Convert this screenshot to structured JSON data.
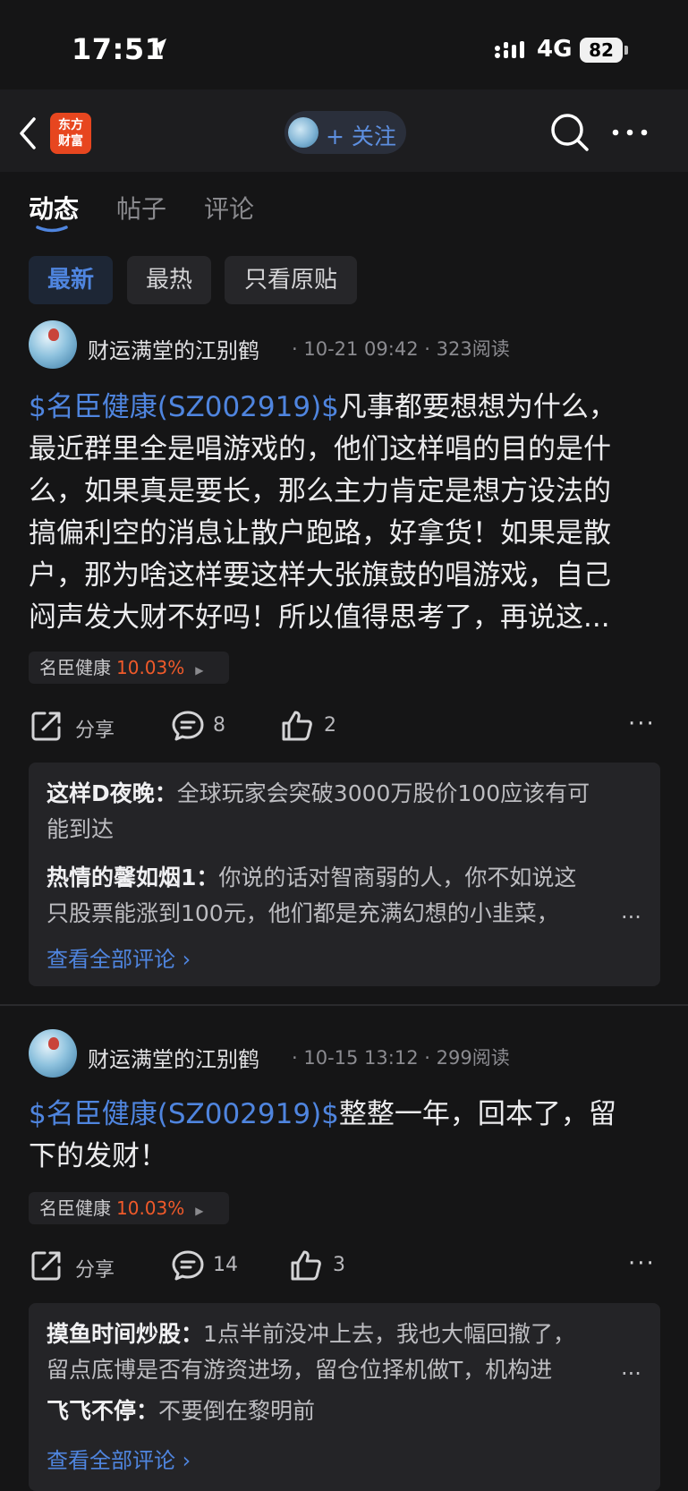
{
  "status_bar": {
    "time": "17:51",
    "network": "4G",
    "battery": "82"
  },
  "nav": {
    "logo_text": "东方财富",
    "follow_label": "+ 关注"
  },
  "tabs": [
    {
      "label": "动态"
    },
    {
      "label": "帖子"
    },
    {
      "label": "评论"
    }
  ],
  "filters": [
    {
      "label": "最新"
    },
    {
      "label": "最热"
    },
    {
      "label": "只看原贴"
    }
  ],
  "colors": {
    "accent_blue": "#4f85df",
    "up_red": "#f05a2a",
    "background": "#151516"
  },
  "posts": [
    {
      "author": "财运满堂的江别鹤",
      "date": "10-21 09:42",
      "reads": "323阅读",
      "cashtag": "$名臣健康(SZ002919)$",
      "body_lines": [
        "凡事都要想想为什么，",
        "最近群里全是唱游戏的，他们这样唱的目的是什",
        "么，如果真是要长，那么主力肯定是想方设法的",
        "搞偏利空的消息让散户跑路，好拿货！如果是散",
        "户，那为啥这样要这样大张旗鼓的唱游戏，自己",
        "闷声发大财不好吗！所以值得思考了，再说这..."
      ],
      "stock": {
        "name": "名臣健康",
        "change": "10.03%"
      },
      "share_label": "分享",
      "comment_count": "8",
      "like_count": "2",
      "comments": [
        {
          "user": "这样D夜晚",
          "sep": "：",
          "text_lines": [
            "全球玩家会突破3000万股价100应该有可",
            "能到达"
          ]
        },
        {
          "user": "热情的馨如烟1",
          "sep": "：",
          "text_lines": [
            "你说的话对智商弱的人，你不如说这",
            "只股票能涨到100元，他们都是充满幻想的小韭菜，"
          ]
        }
      ],
      "ellipsis": "...",
      "view_all": "查看全部评论 ›"
    },
    {
      "author": "财运满堂的江别鹤",
      "date": "10-15 13:12",
      "reads": "299阅读",
      "cashtag": "$名臣健康(SZ002919)$",
      "body_lines": [
        "整整一年，回本了，留",
        "下的发财！"
      ],
      "stock": {
        "name": "名臣健康",
        "change": "10.03%"
      },
      "share_label": "分享",
      "comment_count": "14",
      "like_count": "3",
      "comments": [
        {
          "user": "摸鱼时间炒股",
          "sep": "：",
          "text_lines": [
            "1点半前没冲上去，我也大幅回撤了，",
            "留点底博是否有游资进场，留仓位择机做T，机构进"
          ]
        },
        {
          "user": "飞飞不停",
          "sep": "：",
          "text_lines": [
            "不要倒在黎明前"
          ]
        }
      ],
      "ellipsis": "...",
      "view_all": "查看全部评论 ›"
    }
  ]
}
